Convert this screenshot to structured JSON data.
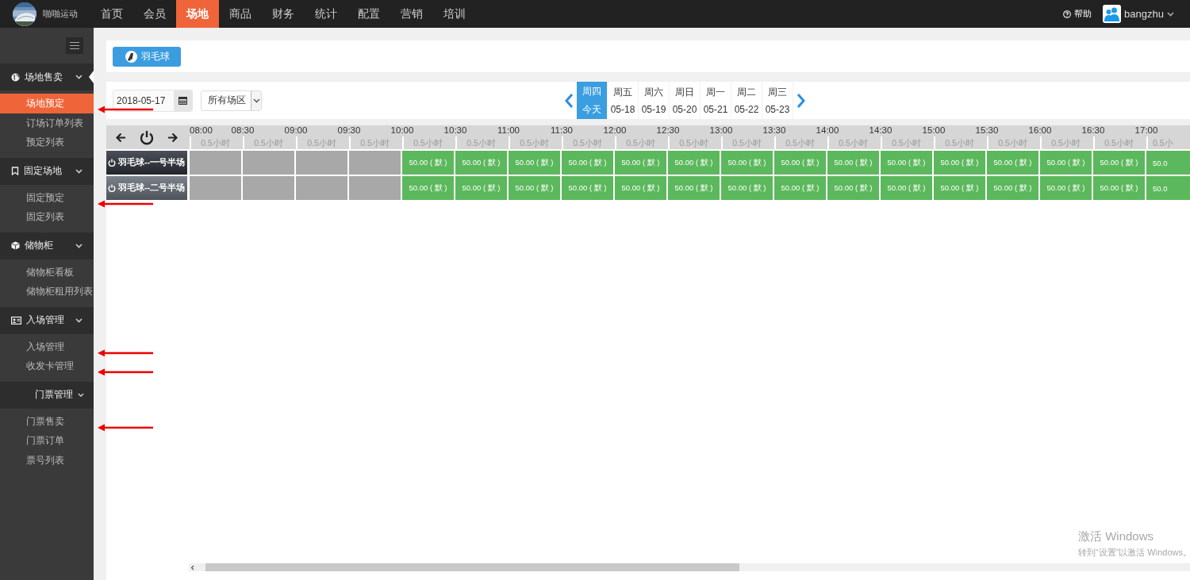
{
  "brand": {
    "name": "啪啪运动"
  },
  "nav": [
    {
      "label": "首页",
      "selected": false
    },
    {
      "label": "会员",
      "selected": false
    },
    {
      "label": "场地",
      "selected": true
    },
    {
      "label": "商品",
      "selected": false
    },
    {
      "label": "财务",
      "selected": false
    },
    {
      "label": "统计",
      "selected": false
    },
    {
      "label": "配置",
      "selected": false
    },
    {
      "label": "营销",
      "selected": false
    },
    {
      "label": "培训",
      "selected": false
    }
  ],
  "help": "帮助",
  "user": {
    "name": "bangzhu"
  },
  "sidebar": {
    "groups": [
      {
        "title": "场地售卖",
        "selected": true,
        "items": [
          {
            "label": "场地预定",
            "selected": true,
            "annotated": true
          },
          {
            "label": "订场订单列表",
            "selected": false
          },
          {
            "label": "预定列表",
            "selected": false
          }
        ]
      },
      {
        "title": "固定场地",
        "selected": false,
        "items": [
          {
            "label": "固定预定",
            "selected": false,
            "annotated": true
          },
          {
            "label": "固定列表",
            "selected": false
          }
        ]
      },
      {
        "title": "储物柜",
        "selected": false,
        "items": [
          {
            "label": "储物柜看板",
            "selected": false
          },
          {
            "label": "储物柜租用列表",
            "selected": false
          }
        ]
      },
      {
        "title": "入场管理",
        "selected": false,
        "items": [
          {
            "label": "入场管理",
            "selected": false,
            "annotated": true
          },
          {
            "label": "收发卡管理",
            "selected": false,
            "annotated": true
          }
        ]
      },
      {
        "title": "门票管理",
        "selected": false,
        "items": [
          {
            "label": "门票售卖",
            "selected": false,
            "annotated": true
          },
          {
            "label": "门票订单",
            "selected": false
          },
          {
            "label": "票号列表",
            "selected": false
          }
        ]
      }
    ]
  },
  "sport_tabs": [
    {
      "label": "羽毛球",
      "selected": true
    }
  ],
  "filters": {
    "date": "2018-05-17",
    "area": "所有场区"
  },
  "days": [
    {
      "weekday": "周四",
      "date": "今天",
      "selected": true
    },
    {
      "weekday": "周五",
      "date": "05-18",
      "selected": false
    },
    {
      "weekday": "周六",
      "date": "05-19",
      "selected": false
    },
    {
      "weekday": "周日",
      "date": "05-20",
      "selected": false
    },
    {
      "weekday": "周一",
      "date": "05-21",
      "selected": false
    },
    {
      "weekday": "周二",
      "date": "05-22",
      "selected": false
    },
    {
      "weekday": "周三",
      "date": "05-23",
      "selected": false
    }
  ],
  "schedule": {
    "times": [
      "08:00",
      "08:30",
      "09:00",
      "09:30",
      "10:00",
      "10:30",
      "11:00",
      "11:30",
      "12:00",
      "12:30",
      "13:00",
      "13:30",
      "14:00",
      "14:30",
      "15:00",
      "15:30",
      "16:00",
      "16:30",
      "17:00"
    ],
    "durations": [
      "0.5小时",
      "0.5小时",
      "0.5小时",
      "0.5小时",
      "0.5小时",
      "0.5小时",
      "0.5小时",
      "0.5小时",
      "0.5小时",
      "0.5小时",
      "0.5小时",
      "0.5小时",
      "0.5小时",
      "0.5小时",
      "0.5小时",
      "0.5小时",
      "0.5小时",
      "0.5小时",
      "0.5小"
    ],
    "rows": [
      {
        "name": "羽毛球--一号半场",
        "selected": true,
        "cells": [
          {
            "kind": "closed"
          },
          {
            "kind": "closed"
          },
          {
            "kind": "closed"
          },
          {
            "kind": "closed"
          },
          {
            "kind": "open",
            "price": "50.00 ( 默 )"
          },
          {
            "kind": "open",
            "price": "50.00 ( 默 )"
          },
          {
            "kind": "open",
            "price": "50.00 ( 默 )"
          },
          {
            "kind": "open",
            "price": "50.00 ( 默 )"
          },
          {
            "kind": "open",
            "price": "50.00 ( 默 )"
          },
          {
            "kind": "open",
            "price": "50.00 ( 默 )"
          },
          {
            "kind": "open",
            "price": "50.00 ( 默 )"
          },
          {
            "kind": "open",
            "price": "50.00 ( 默 )"
          },
          {
            "kind": "open",
            "price": "50.00 ( 默 )"
          },
          {
            "kind": "open",
            "price": "50.00 ( 默 )"
          },
          {
            "kind": "open",
            "price": "50.00 ( 默 )"
          },
          {
            "kind": "open",
            "price": "50.00 ( 默 )"
          },
          {
            "kind": "open",
            "price": "50.00 ( 默 )"
          },
          {
            "kind": "open",
            "price": "50.00 ( 默 )"
          },
          {
            "kind": "open",
            "price": "50.0"
          }
        ]
      },
      {
        "name": "羽毛球--二号半场",
        "selected": false,
        "cells": [
          {
            "kind": "closed"
          },
          {
            "kind": "closed"
          },
          {
            "kind": "closed"
          },
          {
            "kind": "closed"
          },
          {
            "kind": "open",
            "price": "50.00 ( 默 )"
          },
          {
            "kind": "open",
            "price": "50.00 ( 默 )"
          },
          {
            "kind": "open",
            "price": "50.00 ( 默 )"
          },
          {
            "kind": "open",
            "price": "50.00 ( 默 )"
          },
          {
            "kind": "open",
            "price": "50.00 ( 默 )"
          },
          {
            "kind": "open",
            "price": "50.00 ( 默 )"
          },
          {
            "kind": "open",
            "price": "50.00 ( 默 )"
          },
          {
            "kind": "open",
            "price": "50.00 ( 默 )"
          },
          {
            "kind": "open",
            "price": "50.00 ( 默 )"
          },
          {
            "kind": "open",
            "price": "50.00 ( 默 )"
          },
          {
            "kind": "open",
            "price": "50.00 ( 默 )"
          },
          {
            "kind": "open",
            "price": "50.00 ( 默 )"
          },
          {
            "kind": "open",
            "price": "50.00 ( 默 )"
          },
          {
            "kind": "open",
            "price": "50.00 ( 默 )"
          },
          {
            "kind": "open",
            "price": "50.0"
          }
        ]
      }
    ]
  },
  "os_notice": {
    "title": "激活 Windows",
    "subtitle": "转到“设置”以激活 Windows。"
  }
}
